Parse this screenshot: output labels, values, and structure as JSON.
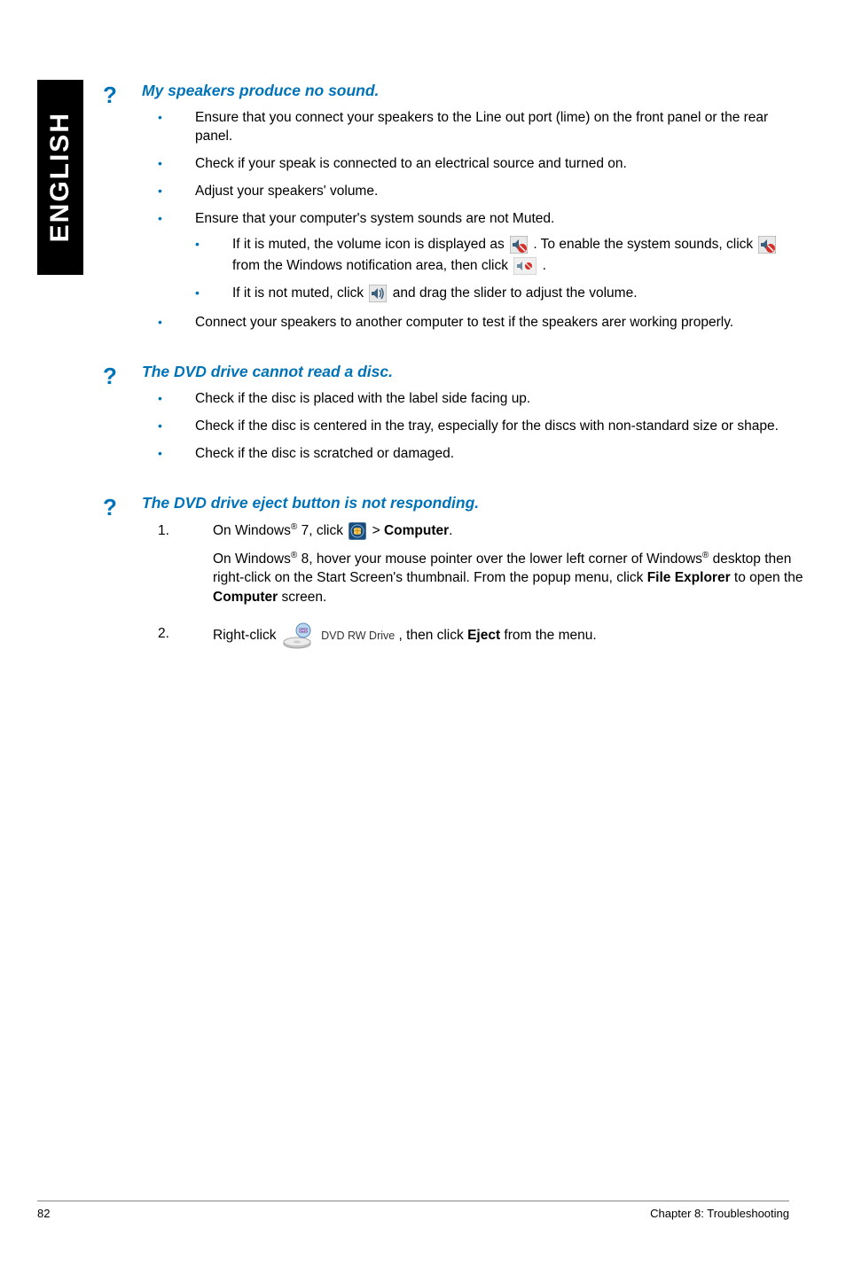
{
  "sidebar": {
    "label": "ENGLISH"
  },
  "sections": {
    "s1": {
      "title": "My speakers produce no sound.",
      "b1": "Ensure that you connect your speakers to the Line out port (lime) on the front panel or the rear panel.",
      "b2": "Check if your speak is connected to an electrical source and turned on.",
      "b3": "Adjust your speakers' volume.",
      "b4": "Ensure that your computer's system sounds are not Muted.",
      "b4a_pre": "If it is muted, the volume icon is displayed as ",
      "b4a_mid": " . To enable the system sounds, click ",
      "b4a_post1": " from the Windows notification area, then click ",
      "b4a_post2": " .",
      "b4b_pre": "If it is not muted, click ",
      "b4b_post": " and drag the slider to adjust the volume.",
      "b5": "Connect your speakers to another computer to test if the speakers arer working properly."
    },
    "s2": {
      "title": "The DVD drive cannot read a disc.",
      "b1": "Check if the disc is placed with the label side facing up.",
      "b2": "Check if the disc is centered in the tray, especially for the discs with non-standard size or shape.",
      "b3": "Check if the disc is scratched or damaged."
    },
    "s3": {
      "title": "The DVD drive eject button is not responding.",
      "step1_pre": "On Windows",
      "step1_mid": " 7, click ",
      "step1_post": " > ",
      "step1_bold": "Computer",
      "step1_end": ".",
      "step1_para_pre": "On Windows",
      "step1_para_mid": " 8, hover your mouse pointer over the lower left corner of Windows",
      "step1_para_post": " desktop then right-click on the Start Screen's thumbnail. From the popup menu, click ",
      "step1_para_b1": "File Explorer",
      "step1_para_mid2": " to open the ",
      "step1_para_b2": "Computer",
      "step1_para_end": " screen.",
      "step2_pre": "Right-click ",
      "step2_dvd": "DVD RW Drive",
      "step2_mid": ", then click ",
      "step2_bold": "Eject",
      "step2_end": " from the menu."
    }
  },
  "footer": {
    "page": "82",
    "chapter": "Chapter 8: Troubleshooting"
  }
}
